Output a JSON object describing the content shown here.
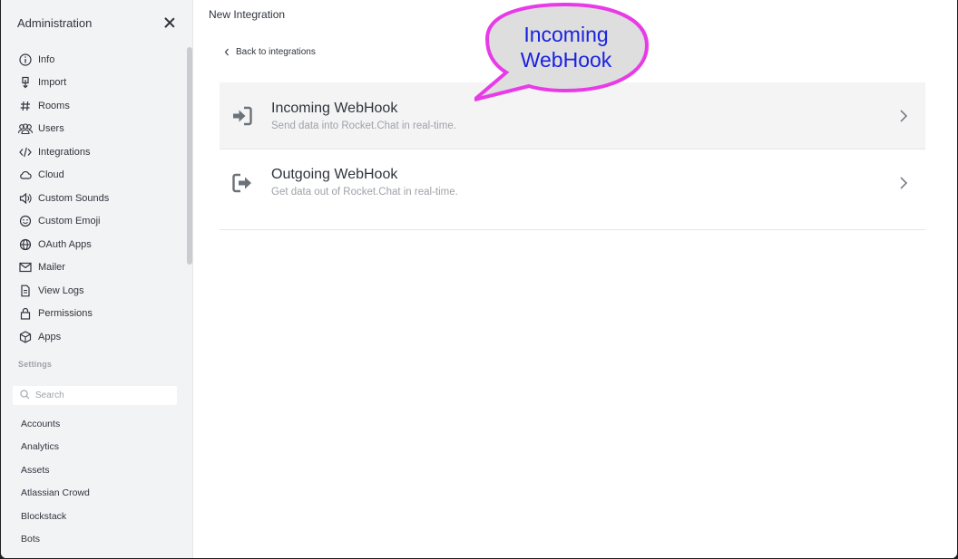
{
  "sidebar": {
    "title": "Administration",
    "nav_items": [
      {
        "label": "Info",
        "icon": "info-icon"
      },
      {
        "label": "Import",
        "icon": "import-icon"
      },
      {
        "label": "Rooms",
        "icon": "hashtag-icon"
      },
      {
        "label": "Users",
        "icon": "users-icon"
      },
      {
        "label": "Integrations",
        "icon": "code-icon"
      },
      {
        "label": "Cloud",
        "icon": "cloud-icon"
      },
      {
        "label": "Custom Sounds",
        "icon": "volume-icon"
      },
      {
        "label": "Custom Emoji",
        "icon": "emoji-icon"
      },
      {
        "label": "OAuth Apps",
        "icon": "globe-icon"
      },
      {
        "label": "Mailer",
        "icon": "mail-icon"
      },
      {
        "label": "View Logs",
        "icon": "document-icon"
      },
      {
        "label": "Permissions",
        "icon": "lock-icon"
      },
      {
        "label": "Apps",
        "icon": "cube-icon"
      }
    ],
    "settings_label": "Settings",
    "search": {
      "placeholder": "Search"
    },
    "settings_items": [
      "Accounts",
      "Analytics",
      "Assets",
      "Atlassian Crowd",
      "Blockstack",
      "Bots"
    ]
  },
  "main": {
    "title": "New Integration",
    "back_label": "Back to integrations",
    "integrations": [
      {
        "title": "Incoming WebHook",
        "description": "Send data into Rocket.Chat in real-time.",
        "icon": "sign-in-icon"
      },
      {
        "title": "Outgoing WebHook",
        "description": "Get data out of Rocket.Chat in real-time.",
        "icon": "sign-out-icon"
      }
    ]
  },
  "annotation": {
    "line1": "Incoming",
    "line2": "WebHook",
    "color": "#1a22e0",
    "bubble_fill": "#dedede",
    "bubble_stroke": "#e83be8"
  }
}
